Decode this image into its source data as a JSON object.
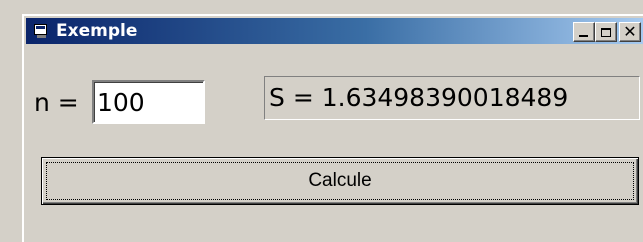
{
  "window": {
    "title": "Exemple",
    "controls": {
      "minimize_icon": "minimize-icon",
      "maximize_icon": "maximize-icon",
      "close_icon": "close-icon",
      "close_glyph": "✕"
    }
  },
  "form": {
    "n_label": "n =",
    "n_value": "100",
    "result_text": "S = 1.63498390018489",
    "calc_button_label": "Calcule"
  },
  "colors": {
    "titlebar_start": "#0a246a",
    "titlebar_end": "#a6caf0",
    "face": "#d4d0c8"
  }
}
